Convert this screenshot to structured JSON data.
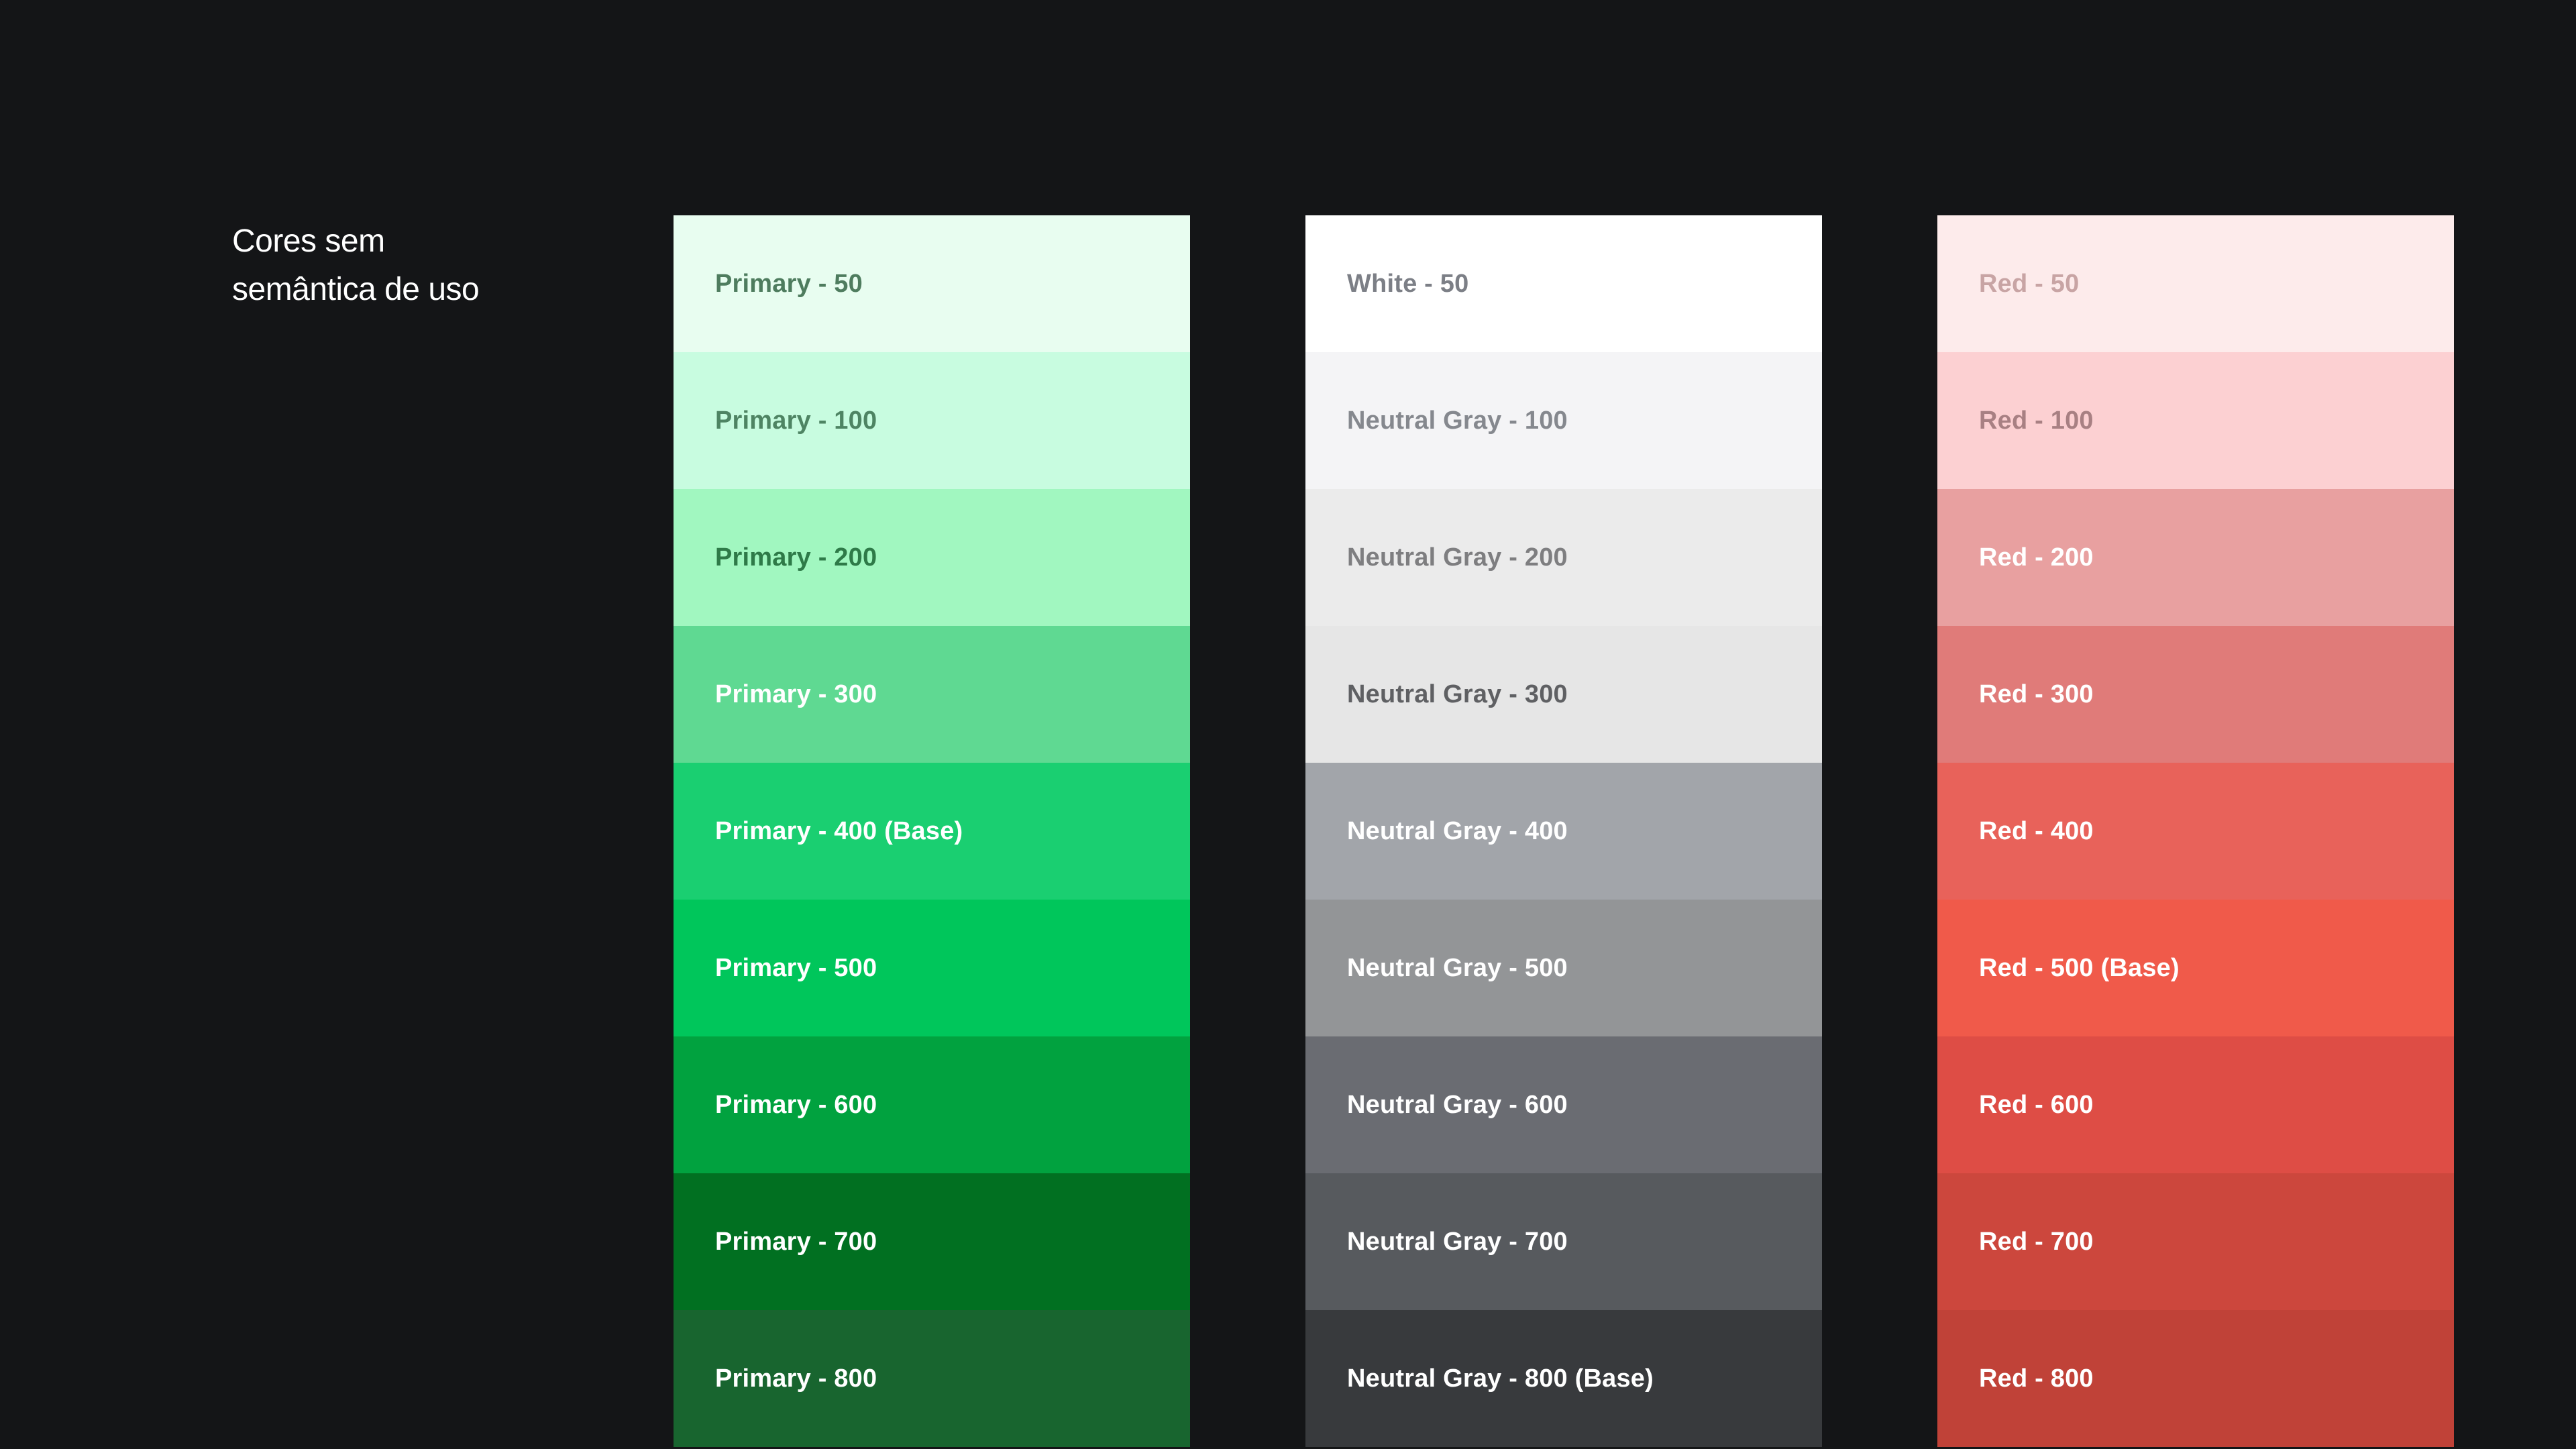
{
  "section": {
    "title_line1": "Cores sem",
    "title_line2": "semântica de uso"
  },
  "palettes": {
    "primary": [
      {
        "label": "Primary - 50",
        "color": "#E8FDF0",
        "text_color": "#4E7C5E"
      },
      {
        "label": "Primary - 100",
        "color": "#C8FCE0",
        "text_color": "#4E8463"
      },
      {
        "label": "Primary - 200",
        "color": "#A1F7C0",
        "text_color": "#2E7A48"
      },
      {
        "label": "Primary - 300",
        "color": "#5FD992",
        "text_color": "#FFFFFF"
      },
      {
        "label": "Primary - 400 (Base)",
        "color": "#1ACF71",
        "text_color": "#FFFFFF"
      },
      {
        "label": "Primary - 500",
        "color": "#00C65B",
        "text_color": "#FFFFFF"
      },
      {
        "label": "Primary - 600",
        "color": "#01A23F",
        "text_color": "#FFFFFF"
      },
      {
        "label": "Primary - 700",
        "color": "#017021",
        "text_color": "#FFFFFF"
      },
      {
        "label": "Primary - 800",
        "color": "#18652F",
        "text_color": "#FFFFFF"
      }
    ],
    "neutral": [
      {
        "label": "White - 50",
        "color": "#FFFFFF",
        "text_color": "#7C7F86"
      },
      {
        "label": "Neutral Gray - 100",
        "color": "#F4F4F6",
        "text_color": "#85888E"
      },
      {
        "label": "Neutral Gray - 200",
        "color": "#EBEBEB",
        "text_color": "#7E7E80"
      },
      {
        "label": "Neutral Gray - 300",
        "color": "#E6E6E6",
        "text_color": "#5F6063"
      },
      {
        "label": "Neutral Gray - 400",
        "color": "#A2A5AA",
        "text_color": "#FFFFFF"
      },
      {
        "label": "Neutral Gray - 500",
        "color": "#939597",
        "text_color": "#FFFFFF"
      },
      {
        "label": "Neutral Gray - 600",
        "color": "#6A6C72",
        "text_color": "#FFFFFF"
      },
      {
        "label": "Neutral Gray - 700",
        "color": "#575A5E",
        "text_color": "#FFFFFF"
      },
      {
        "label": "Neutral Gray - 800 (Base)",
        "color": "#383A3D",
        "text_color": "#FFFFFF"
      }
    ],
    "red": [
      {
        "label": "Red - 50",
        "color": "#FDEBEB",
        "text_color": "#C8A4A4"
      },
      {
        "label": "Red - 100",
        "color": "#FCD0D2",
        "text_color": "#A88083"
      },
      {
        "label": "Red - 200",
        "color": "#E8A0A0",
        "text_color": "#FFFFFF"
      },
      {
        "label": "Red - 300",
        "color": "#E07B79",
        "text_color": "#FFFFFF"
      },
      {
        "label": "Red - 400",
        "color": "#E8625A",
        "text_color": "#FFFFFF"
      },
      {
        "label": "Red - 500 (Base)",
        "color": "#F05A4A",
        "text_color": "#FFFFFF"
      },
      {
        "label": "Red - 600",
        "color": "#DE4D45",
        "text_color": "#FFFFFF"
      },
      {
        "label": "Red - 700",
        "color": "#CC473D",
        "text_color": "#FFFFFF"
      },
      {
        "label": "Red - 800",
        "color": "#C04238",
        "text_color": "#FFFFFF"
      }
    ]
  },
  "colors": {
    "background": "#141517",
    "title_text": "#FFFFFF"
  }
}
